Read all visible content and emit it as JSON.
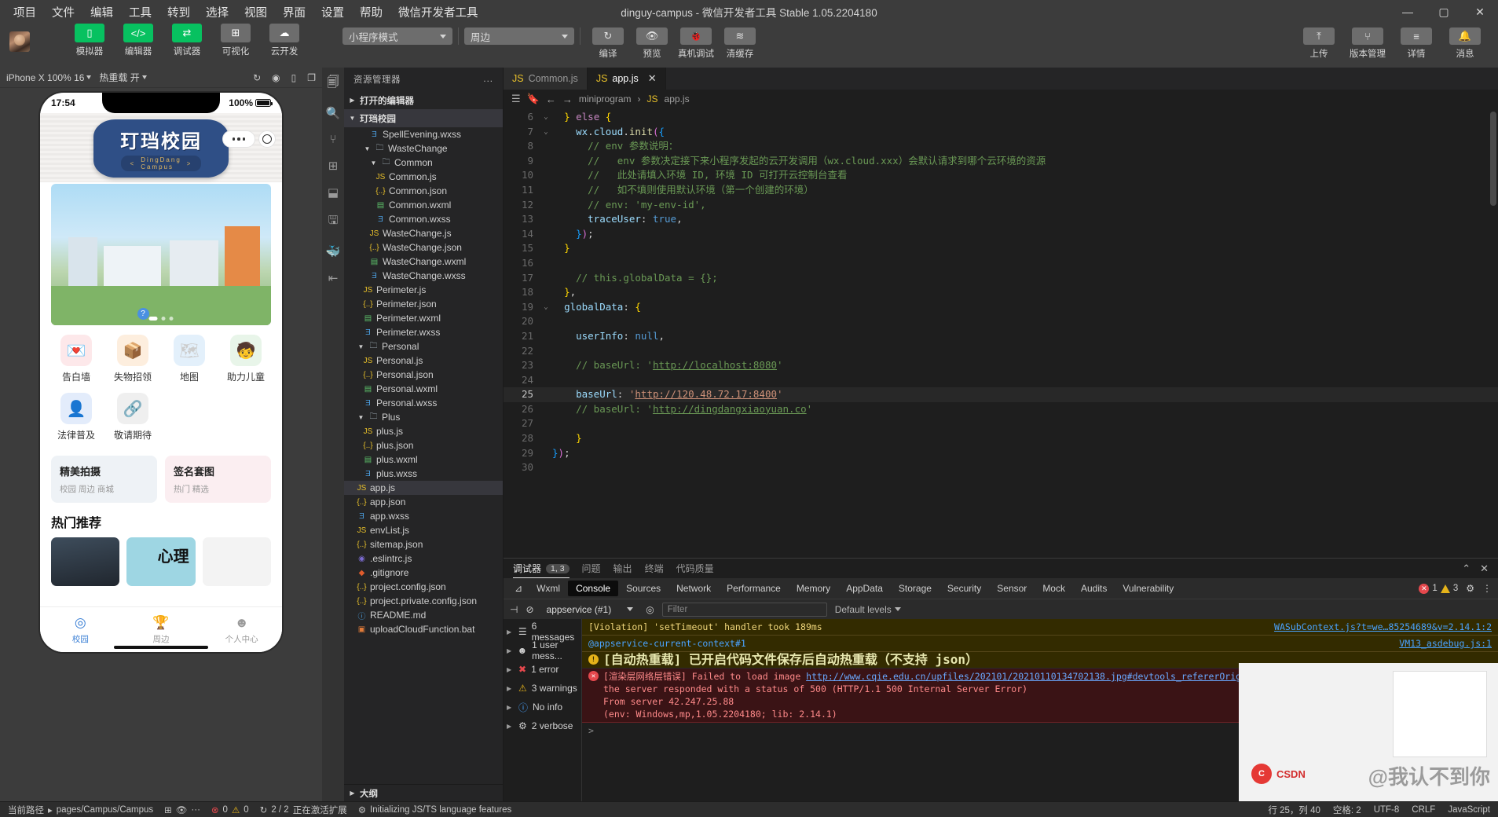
{
  "window": {
    "title": "dinguy-campus - 微信开发者工具 Stable 1.05.2204180",
    "minimize": "—",
    "maximize": "▢",
    "close": "✕"
  },
  "menu": [
    "项目",
    "文件",
    "编辑",
    "工具",
    "转到",
    "选择",
    "视图",
    "界面",
    "设置",
    "帮助",
    "微信开发者工具"
  ],
  "toolbar": {
    "left_buttons": [
      {
        "name": "simulator",
        "label": "模拟器",
        "icon": "phone-icon",
        "glyph": "▯",
        "green": true
      },
      {
        "name": "editor",
        "label": "编辑器",
        "icon": "code-icon",
        "glyph": "</>",
        "green": true
      },
      {
        "name": "debugger",
        "label": "调试器",
        "icon": "sliders-icon",
        "glyph": "⇄",
        "green": true
      },
      {
        "name": "visual",
        "label": "可视化",
        "icon": "layout-icon",
        "glyph": "⊞",
        "green": false
      },
      {
        "name": "cloud",
        "label": "云开发",
        "icon": "cloud-icon",
        "glyph": "☁",
        "green": false
      }
    ],
    "mode_select": "小程序模式",
    "page_select": "周边",
    "mid_buttons": [
      {
        "name": "compile",
        "label": "编译",
        "icon": "refresh-icon",
        "glyph": "↻"
      },
      {
        "name": "preview",
        "label": "预览",
        "icon": "eye-icon",
        "glyph": "👁"
      },
      {
        "name": "device-debug",
        "label": "真机调试",
        "icon": "bug-icon",
        "glyph": "🐞"
      },
      {
        "name": "clear-cache",
        "label": "清缓存",
        "icon": "layers-icon",
        "glyph": "≋"
      }
    ],
    "right_buttons": [
      {
        "name": "upload",
        "label": "上传",
        "icon": "upload-icon",
        "glyph": "⤒"
      },
      {
        "name": "version",
        "label": "版本管理",
        "icon": "branch-icon",
        "glyph": "⑂"
      },
      {
        "name": "details",
        "label": "详情",
        "icon": "menu-icon",
        "glyph": "≡"
      },
      {
        "name": "messages",
        "label": "消息",
        "icon": "bell-icon",
        "glyph": "🔔"
      }
    ]
  },
  "simulator": {
    "device": "iPhone X 100% 16",
    "hot_reload": "热重载 开",
    "phone": {
      "time": "17:54",
      "battery": "100%",
      "logo_cn": "玎珰校园",
      "logo_en_left": "<",
      "logo_en": "DingDang",
      "logo_en_sub": "Campus",
      "logo_en_right": ">",
      "grid": [
        {
          "label": "告白墙",
          "glyph": "💌",
          "bg": "#fde8ea"
        },
        {
          "label": "失物招领",
          "glyph": "📦",
          "bg": "#fdeede",
          "badge": "?"
        },
        {
          "label": "地图",
          "glyph": "🗺",
          "bg": "#e3f0fb"
        },
        {
          "label": "助力儿童",
          "glyph": "🧒",
          "bg": "#e8f5e9"
        },
        {
          "label": "法律普及",
          "glyph": "👤",
          "bg": "#e3ecfb"
        },
        {
          "label": "敬请期待",
          "glyph": "🔗",
          "bg": "#efefef"
        }
      ],
      "promos": [
        {
          "title": "精美拍摄",
          "sub": "校园 周边 商城"
        },
        {
          "title": "签名套图",
          "sub": "热门 精选"
        }
      ],
      "hot_title": "热门推荐",
      "tabs": [
        {
          "label": "校园",
          "glyph": "◎",
          "active": true
        },
        {
          "label": "周边",
          "glyph": "🏆",
          "active": false
        },
        {
          "label": "个人中心",
          "glyph": "☻",
          "active": false
        }
      ]
    }
  },
  "explorer": {
    "title": "资源管理器",
    "more": "...",
    "sections": [
      {
        "label": "打开的编辑器",
        "open": false
      },
      {
        "label": "玎珰校园",
        "open": true
      }
    ],
    "outline": "大纲",
    "tree": [
      {
        "indent": 4,
        "icon": "wxss",
        "label": "SpellEvening.wxss",
        "type": "file"
      },
      {
        "indent": 3,
        "icon": "folder",
        "label": "WasteChange",
        "type": "folder",
        "open": true
      },
      {
        "indent": 4,
        "icon": "folder",
        "label": "Common",
        "type": "folder",
        "open": true
      },
      {
        "indent": 5,
        "icon": "js",
        "label": "Common.js",
        "type": "file"
      },
      {
        "indent": 5,
        "icon": "json",
        "label": "Common.json",
        "type": "file"
      },
      {
        "indent": 5,
        "icon": "wxml",
        "label": "Common.wxml",
        "type": "file"
      },
      {
        "indent": 5,
        "icon": "wxss",
        "label": "Common.wxss",
        "type": "file"
      },
      {
        "indent": 4,
        "icon": "js",
        "label": "WasteChange.js",
        "type": "file"
      },
      {
        "indent": 4,
        "icon": "json",
        "label": "WasteChange.json",
        "type": "file"
      },
      {
        "indent": 4,
        "icon": "wxml",
        "label": "WasteChange.wxml",
        "type": "file"
      },
      {
        "indent": 4,
        "icon": "wxss",
        "label": "WasteChange.wxss",
        "type": "file"
      },
      {
        "indent": 3,
        "icon": "js",
        "label": "Perimeter.js",
        "type": "file"
      },
      {
        "indent": 3,
        "icon": "json",
        "label": "Perimeter.json",
        "type": "file"
      },
      {
        "indent": 3,
        "icon": "wxml",
        "label": "Perimeter.wxml",
        "type": "file"
      },
      {
        "indent": 3,
        "icon": "wxss",
        "label": "Perimeter.wxss",
        "type": "file"
      },
      {
        "indent": 2,
        "icon": "folder",
        "label": "Personal",
        "type": "folder",
        "open": true
      },
      {
        "indent": 3,
        "icon": "js",
        "label": "Personal.js",
        "type": "file"
      },
      {
        "indent": 3,
        "icon": "json",
        "label": "Personal.json",
        "type": "file"
      },
      {
        "indent": 3,
        "icon": "wxml",
        "label": "Personal.wxml",
        "type": "file"
      },
      {
        "indent": 3,
        "icon": "wxss",
        "label": "Personal.wxss",
        "type": "file"
      },
      {
        "indent": 2,
        "icon": "folder",
        "label": "Plus",
        "type": "folder",
        "open": true
      },
      {
        "indent": 3,
        "icon": "js",
        "label": "plus.js",
        "type": "file"
      },
      {
        "indent": 3,
        "icon": "json",
        "label": "plus.json",
        "type": "file"
      },
      {
        "indent": 3,
        "icon": "wxml",
        "label": "plus.wxml",
        "type": "file"
      },
      {
        "indent": 3,
        "icon": "wxss",
        "label": "plus.wxss",
        "type": "file"
      },
      {
        "indent": 2,
        "icon": "js",
        "label": "app.js",
        "type": "file",
        "selected": true
      },
      {
        "indent": 2,
        "icon": "json",
        "label": "app.json",
        "type": "file"
      },
      {
        "indent": 2,
        "icon": "wxss",
        "label": "app.wxss",
        "type": "file"
      },
      {
        "indent": 2,
        "icon": "js",
        "label": "envList.js",
        "type": "file"
      },
      {
        "indent": 2,
        "icon": "json",
        "label": "sitemap.json",
        "type": "file"
      },
      {
        "indent": 2,
        "icon": "eslint",
        "label": ".eslintrc.js",
        "type": "file"
      },
      {
        "indent": 2,
        "icon": "git",
        "label": ".gitignore",
        "type": "file"
      },
      {
        "indent": 2,
        "icon": "cfg",
        "label": "project.config.json",
        "type": "file"
      },
      {
        "indent": 2,
        "icon": "cfg",
        "label": "project.private.config.json",
        "type": "file"
      },
      {
        "indent": 2,
        "icon": "md",
        "label": "README.md",
        "type": "file"
      },
      {
        "indent": 2,
        "icon": "bat",
        "label": "uploadCloudFunction.bat",
        "type": "file"
      }
    ]
  },
  "editor": {
    "tabs": [
      {
        "label": "Common.js",
        "icon": "js",
        "active": false
      },
      {
        "label": "app.js",
        "icon": "js",
        "active": true,
        "close": "✕"
      }
    ],
    "breadcrumb": [
      "miniprogram",
      "app.js"
    ],
    "lines": [
      {
        "n": 6,
        "fold": "⌄",
        "html": "  <span class='brk'>}</span> <span class='kw2'>else</span> <span class='brk'>{</span>"
      },
      {
        "n": 7,
        "fold": "⌄",
        "html": "    <span class='pr'>wx</span>.<span class='pr'>cloud</span>.<span class='fn'>init</span><span class='brk2'>(</span><span class='brk3'>{</span>"
      },
      {
        "n": 8,
        "fold": "",
        "html": "      <span class='cm'>// env 参数说明：</span>"
      },
      {
        "n": 9,
        "fold": "",
        "html": "      <span class='cm'>//   env 参数决定接下来小程序发起的云开发调用（wx.cloud.xxx）会默认请求到哪个云环境的资源</span>"
      },
      {
        "n": 10,
        "fold": "",
        "html": "      <span class='cm'>//   此处请填入环境 ID, 环境 ID 可打开云控制台查看</span>"
      },
      {
        "n": 11,
        "fold": "",
        "html": "      <span class='cm'>//   如不填则使用默认环境（第一个创建的环境）</span>"
      },
      {
        "n": 12,
        "fold": "",
        "html": "      <span class='cm'>// env: 'my-env-id',</span>"
      },
      {
        "n": 13,
        "fold": "",
        "html": "      <span class='pr'>traceUser</span><span class='op'>:</span> <span class='kw'>true</span><span class='op'>,</span>"
      },
      {
        "n": 14,
        "fold": "",
        "html": "    <span class='brk3'>}</span><span class='brk2'>)</span><span class='op'>;</span>"
      },
      {
        "n": 15,
        "fold": "",
        "html": "  <span class='brk'>}</span>"
      },
      {
        "n": 16,
        "fold": "",
        "html": ""
      },
      {
        "n": 17,
        "fold": "",
        "html": "    <span class='cm'>// this.globalData = {};</span>"
      },
      {
        "n": 18,
        "fold": "",
        "html": "  <span class='brk'>}</span><span class='op'>,</span>"
      },
      {
        "n": 19,
        "fold": "⌄",
        "html": "  <span class='pr'>globalData</span><span class='op'>:</span> <span class='brk'>{</span>"
      },
      {
        "n": 20,
        "fold": "",
        "html": ""
      },
      {
        "n": 21,
        "fold": "",
        "html": "    <span class='pr'>userInfo</span><span class='op'>:</span> <span class='kw'>null</span><span class='op'>,</span>"
      },
      {
        "n": 22,
        "fold": "",
        "html": ""
      },
      {
        "n": 23,
        "fold": "",
        "html": "    <span class='cm'>// baseUrl: '</span><span class='lnk'>http://localhost:8080</span><span class='cm'>'</span>"
      },
      {
        "n": 24,
        "fold": "",
        "html": ""
      },
      {
        "n": 25,
        "fold": "",
        "html": "    <span class='pr'>baseUrl</span><span class='op'>:</span> <span class='str'>'</span><span class='lnk2'>http://120.48.72.17:8400</span><span class='str'>'</span>",
        "hl": true
      },
      {
        "n": 26,
        "fold": "",
        "html": "    <span class='cm'>// baseUrl: '</span><span class='lnk'>http://dingdangxiaoyuan.co</span><span class='cm'>'</span>"
      },
      {
        "n": 27,
        "fold": "",
        "html": ""
      },
      {
        "n": 28,
        "fold": "",
        "html": "    <span class='brk'>}</span>"
      },
      {
        "n": 29,
        "fold": "",
        "html": "<span class='brk3'>}</span><span class='brk2'>)</span><span class='op'>;</span>"
      },
      {
        "n": 30,
        "fold": "",
        "html": ""
      }
    ]
  },
  "panel": {
    "tabs": [
      {
        "label": "调试器",
        "count": "1, 3",
        "active": true
      },
      {
        "label": "问题",
        "active": false
      },
      {
        "label": "输出",
        "active": false
      },
      {
        "label": "终端",
        "active": false
      },
      {
        "label": "代码质量",
        "active": false
      }
    ],
    "collapse_icon": "⌃",
    "close_icon": "✕",
    "devtools_tabs": [
      "Wxml",
      "Console",
      "Sources",
      "Network",
      "Performance",
      "Memory",
      "AppData",
      "Storage",
      "Security",
      "Sensor",
      "Mock",
      "Audits",
      "Vulnerability"
    ],
    "devtools_active": "Console",
    "error_count": "1",
    "warning_count": "3",
    "context": "appservice (#1)",
    "filter_placeholder": "Filter",
    "levels": "Default levels",
    "groups": [
      {
        "label": "6 messages",
        "icon": "list-icon"
      },
      {
        "label": "1 user mess...",
        "icon": "user-icon"
      },
      {
        "label": "1 error",
        "icon": "error-icon"
      },
      {
        "label": "3 warnings",
        "icon": "warning-icon"
      },
      {
        "label": "No info",
        "icon": "info-icon"
      },
      {
        "label": "2 verbose",
        "icon": "gear-icon"
      }
    ],
    "messages": [
      {
        "type": "warn",
        "text": "[Violation] 'setTimeout' handler took 189ms",
        "source": "WASubContext.js?t=we…85254689&v=2.14.1:2"
      },
      {
        "type": "warnlink",
        "text": "@appservice-current-context#1",
        "source": "VM13_asdebug.js:1"
      },
      {
        "type": "hot",
        "badge": "!",
        "text": "[自动热重载] 已开启代码文件保存后自动热重载（不支持 json）"
      },
      {
        "type": "err",
        "badge": "✕",
        "lines": [
          "[渲染层网络层错误] Failed to load image http://www.cqie.edu.cn/upfiles/202101/20210110134702138.jpg#devtools_refererOrigin",
          "the server responded with a status of 500 (HTTP/1.1 500 Internal Server Error)",
          "From server 42.247.25.88",
          "(env: Windows,mp,1.05.2204180; lib: 2.14.1)"
        ]
      }
    ],
    "prompt": ">"
  },
  "status": {
    "path_label": "当前路径",
    "path": "pages/Campus/Campus",
    "errors": "0",
    "warnings": "0",
    "progress": "2 / 2",
    "activating": "正在激活扩展",
    "init": "Initializing JS/TS language features",
    "line_col": "行 25，列 40",
    "spaces": "空格: 2",
    "encoding": "UTF-8",
    "eol": "CRLF",
    "lang": "JavaScript"
  },
  "watermark": {
    "brand": "CSDN",
    "logo": "C",
    "text": "@我认不到你"
  }
}
